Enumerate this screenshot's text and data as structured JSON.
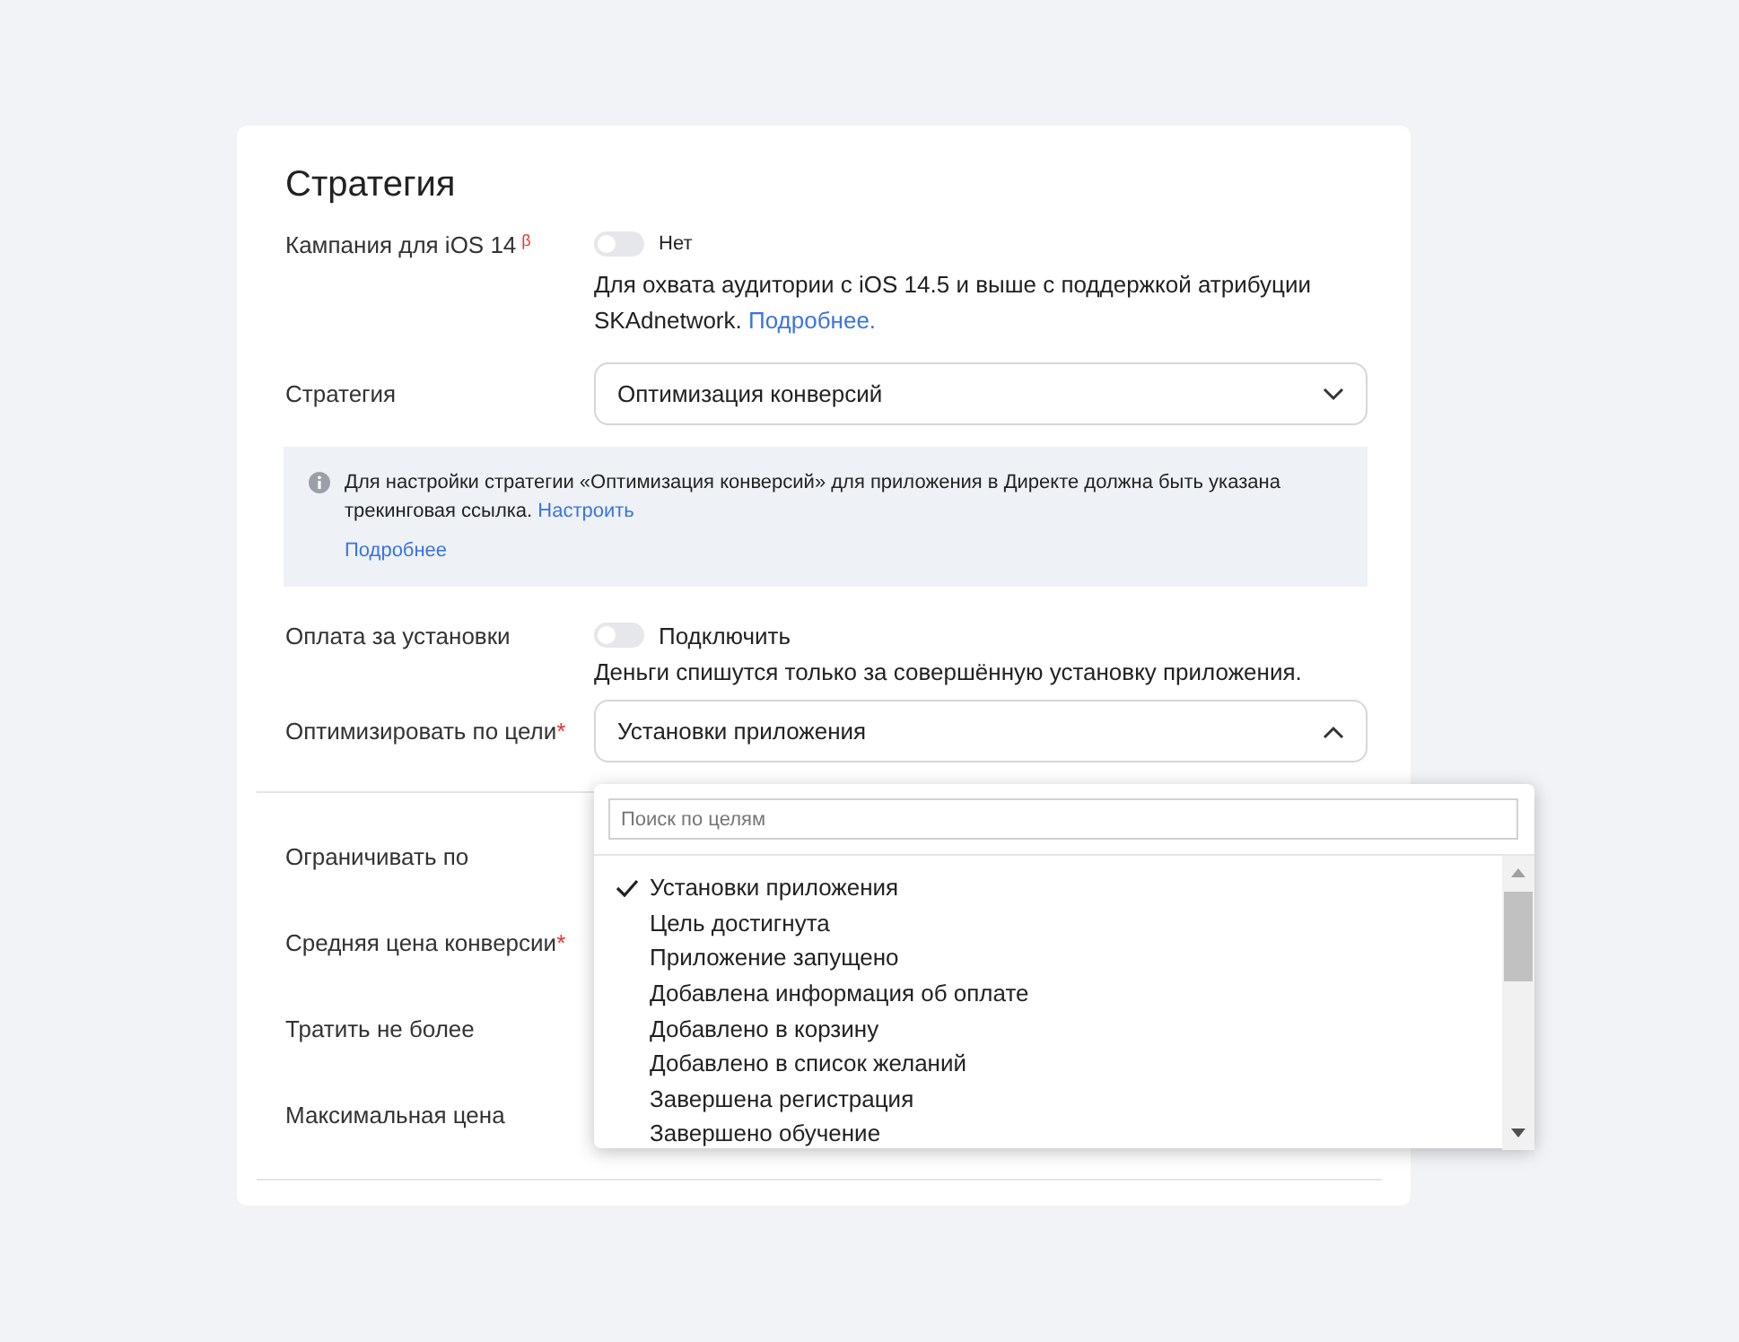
{
  "title": "Стратегия",
  "ios": {
    "label": "Кампания для iOS 14",
    "badge": "β",
    "on": false,
    "toggle_label": "Нет",
    "hint": "Для охвата аудитории с iOS 14.5 и выше с поддержкой атрибуции SKAdnetwork.",
    "link": "Подробнее."
  },
  "strategy": {
    "label": "Стратегия",
    "value": "Оптимизация конверсий",
    "expanded": false
  },
  "notice": {
    "text": "Для настройки стратегии «Оптимизация конверсий» для приложения в Директе должна быть указана трекинговая ссылка.",
    "link": "Настроить",
    "more": "Подробнее"
  },
  "install_pay": {
    "label": "Оплата за установки",
    "on": false,
    "toggle_label": "Подключить",
    "hint": "Деньги спишутся только за совершённую установку приложения."
  },
  "goal": {
    "label": "Оптимизировать по цели",
    "required_mark": "*",
    "value": "Установки приложения",
    "expanded": true,
    "search_placeholder": "Поиск по целям",
    "options": [
      {
        "label": "Установки приложения",
        "selected": true
      },
      {
        "label": "Цель достигнута",
        "selected": false
      },
      {
        "label": "Приложение запущено",
        "selected": false
      },
      {
        "label": "Добавлена информация об оплате",
        "selected": false
      },
      {
        "label": "Добавлено в корзину",
        "selected": false
      },
      {
        "label": "Добавлено в список желаний",
        "selected": false
      },
      {
        "label": "Завершена регистрация",
        "selected": false
      },
      {
        "label": "Завершено обучение",
        "selected": false
      }
    ]
  },
  "limits": [
    {
      "label": "Ограничивать по"
    },
    {
      "label": "Средняя цена конверсии",
      "required_mark": "*"
    },
    {
      "label": "Тратить не более"
    },
    {
      "label": "Максимальная цена"
    }
  ]
}
